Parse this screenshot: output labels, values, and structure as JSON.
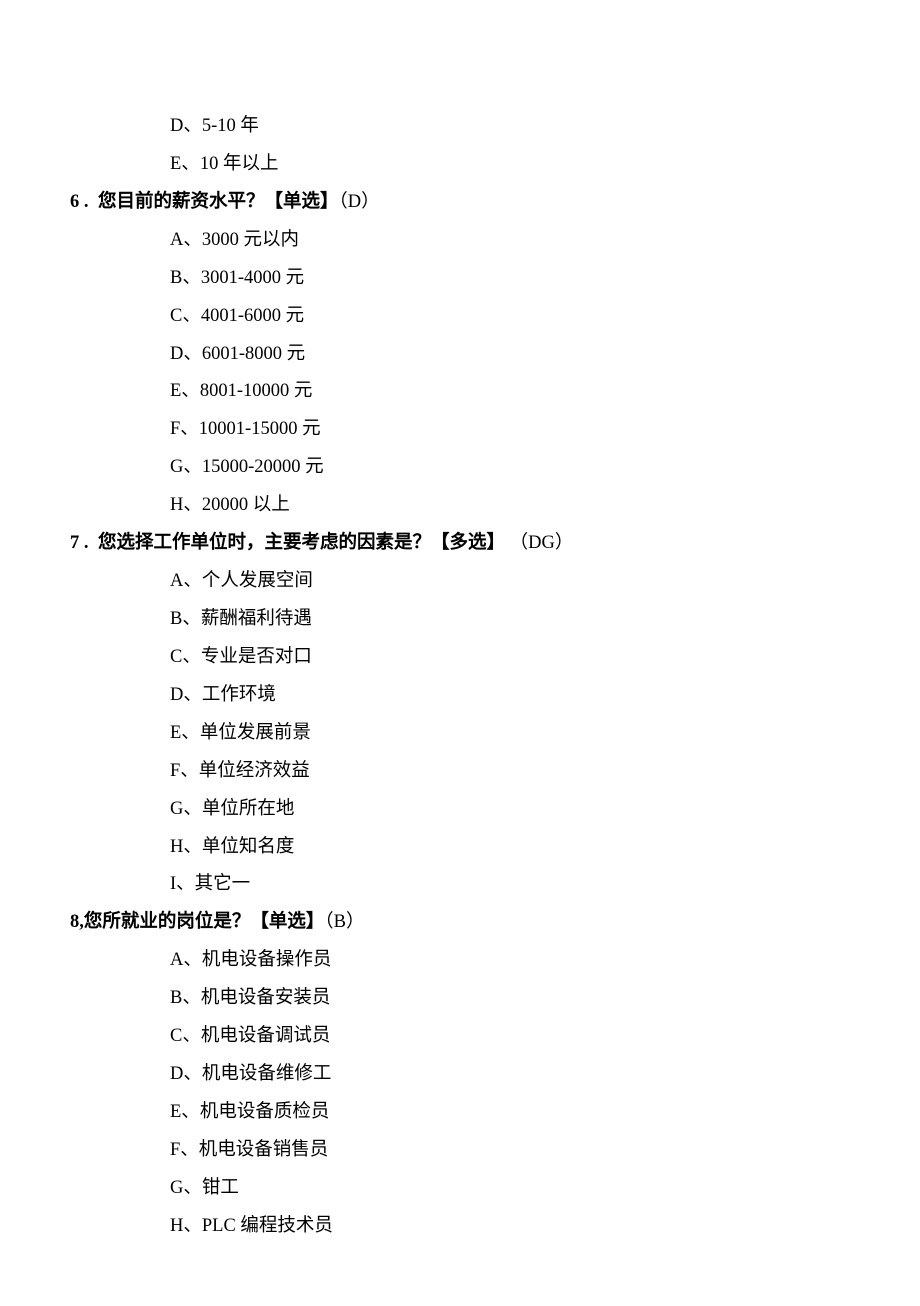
{
  "prev_q_tail": {
    "options": [
      {
        "label": "D、",
        "text": "5-10 年"
      },
      {
        "label": "E、",
        "text": "10 年以上"
      }
    ]
  },
  "q6": {
    "num": "6 .",
    "text": "您目前的薪资水平？",
    "tag": "【单选】",
    "ans": "（D）",
    "options": [
      {
        "label": "A、",
        "text": "3000 元以内"
      },
      {
        "label": "B、",
        "text": "3001-4000 元"
      },
      {
        "label": "C、",
        "text": "4001-6000 元"
      },
      {
        "label": "D、",
        "text": "6001-8000 元"
      },
      {
        "label": "E、",
        "text": "8001-10000 元"
      },
      {
        "label": "F、",
        "text": "10001-15000 元"
      },
      {
        "label": "G、",
        "text": "15000-20000 元"
      },
      {
        "label": "H、",
        "text": "20000 以上"
      }
    ]
  },
  "q7": {
    "num": "7 .",
    "text": "您选择工作单位时，主要考虑的因素是？",
    "tag": "【多选】",
    "ans": " （DG）",
    "options": [
      {
        "label": "A、",
        "text": "个人发展空间"
      },
      {
        "label": "B、",
        "text": "薪酬福利待遇"
      },
      {
        "label": "C、",
        "text": "专业是否对口"
      },
      {
        "label": "D、",
        "text": "工作环境"
      },
      {
        "label": "E、",
        "text": "单位发展前景"
      },
      {
        "label": "F、",
        "text": "单位经济效益"
      },
      {
        "label": "G、",
        "text": "单位所在地"
      },
      {
        "label": "H、",
        "text": "单位知名度"
      },
      {
        "label": "I、",
        "text": "其它一"
      }
    ]
  },
  "q8": {
    "num": "8,",
    "text": "您所就业的岗位是？",
    "tag": "【单选】",
    "ans": "（B）",
    "options": [
      {
        "label": "A、",
        "text": "机电设备操作员"
      },
      {
        "label": "B、",
        "text": "机电设备安装员"
      },
      {
        "label": "C、",
        "text": "机电设备调试员"
      },
      {
        "label": "D、",
        "text": "机电设备维修工"
      },
      {
        "label": "E、",
        "text": "机电设备质检员"
      },
      {
        "label": "F、",
        "text": "机电设备销售员"
      },
      {
        "label": "G、",
        "text": "钳工"
      },
      {
        "label": "H、",
        "text": "PLC 编程技术员"
      }
    ]
  }
}
